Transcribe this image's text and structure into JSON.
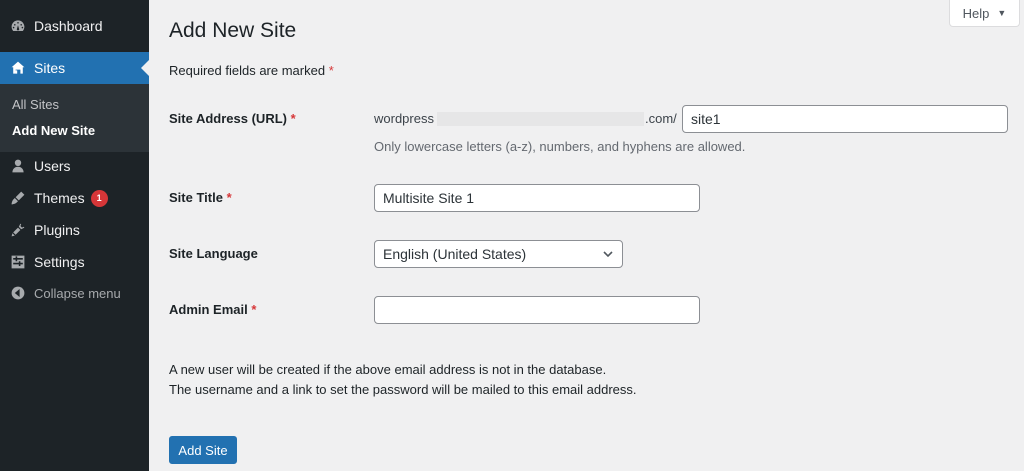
{
  "sidebar": {
    "items": [
      {
        "label": "Dashboard",
        "icon": "dashboard-icon"
      },
      {
        "label": "Sites",
        "icon": "sites-icon"
      },
      {
        "label": "Users",
        "icon": "users-icon"
      },
      {
        "label": "Themes",
        "icon": "themes-icon",
        "badge": "1"
      },
      {
        "label": "Plugins",
        "icon": "plugins-icon"
      },
      {
        "label": "Settings",
        "icon": "settings-icon"
      },
      {
        "label": "Collapse menu",
        "icon": "collapse-icon"
      }
    ],
    "submenu": [
      {
        "label": "All Sites"
      },
      {
        "label": "Add New Site"
      }
    ]
  },
  "help": {
    "label": "Help",
    "arrow": "▼"
  },
  "page": {
    "title": "Add New Site",
    "required_note": "Required fields are marked",
    "star": "*"
  },
  "form": {
    "site_address": {
      "label": "Site Address (URL)",
      "prefix": "wordpress",
      "suffix": ".com/",
      "value": "site1",
      "hint": "Only lowercase letters (a-z), numbers, and hyphens are allowed."
    },
    "site_title": {
      "label": "Site Title",
      "value": "Multisite Site 1"
    },
    "site_language": {
      "label": "Site Language",
      "value": "English (United States)"
    },
    "admin_email": {
      "label": "Admin Email",
      "value": ""
    }
  },
  "info": {
    "line1": "A new user will be created if the above email address is not in the database.",
    "line2": "The username and a link to set the password will be mailed to this email address."
  },
  "submit": {
    "label": "Add Site"
  },
  "colors": {
    "sidebar": "#1d2327",
    "accent": "#2271b1",
    "required": "#d63638",
    "background": "#f0f0f1"
  }
}
